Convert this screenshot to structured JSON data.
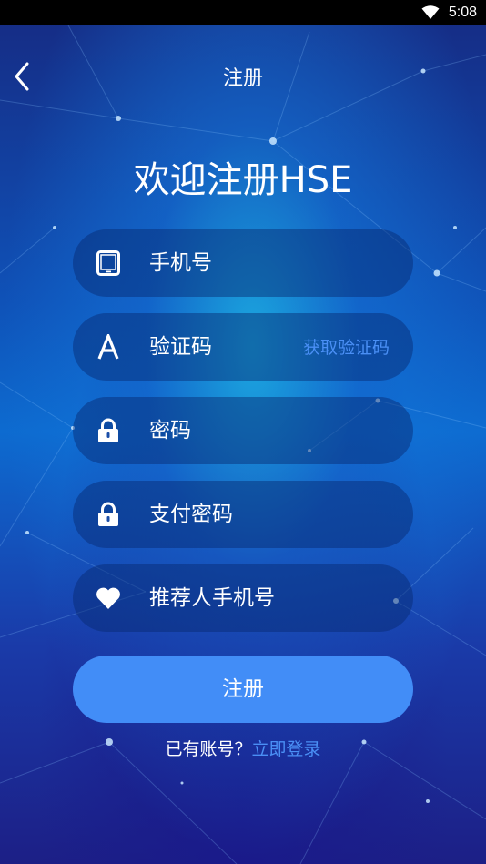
{
  "status": {
    "time": "5:08"
  },
  "nav": {
    "title": "注册"
  },
  "welcome": "欢迎注册HSE",
  "fields": {
    "phone": "手机号",
    "code": "验证码",
    "get_code": "获取验证码",
    "password": "密码",
    "pay_password": "支付密码",
    "referrer": "推荐人手机号"
  },
  "submit": "注册",
  "login": {
    "prompt": "已有账号？",
    "link": "立即登录"
  },
  "icons": {
    "back": "chevron-left-icon",
    "phone": "tablet-icon",
    "code": "letter-a-icon",
    "password": "lock-icon",
    "pay_password": "lock-icon",
    "referrer": "heart-icon"
  },
  "colors": {
    "accent": "#428df7",
    "link": "#4a8ff5"
  }
}
